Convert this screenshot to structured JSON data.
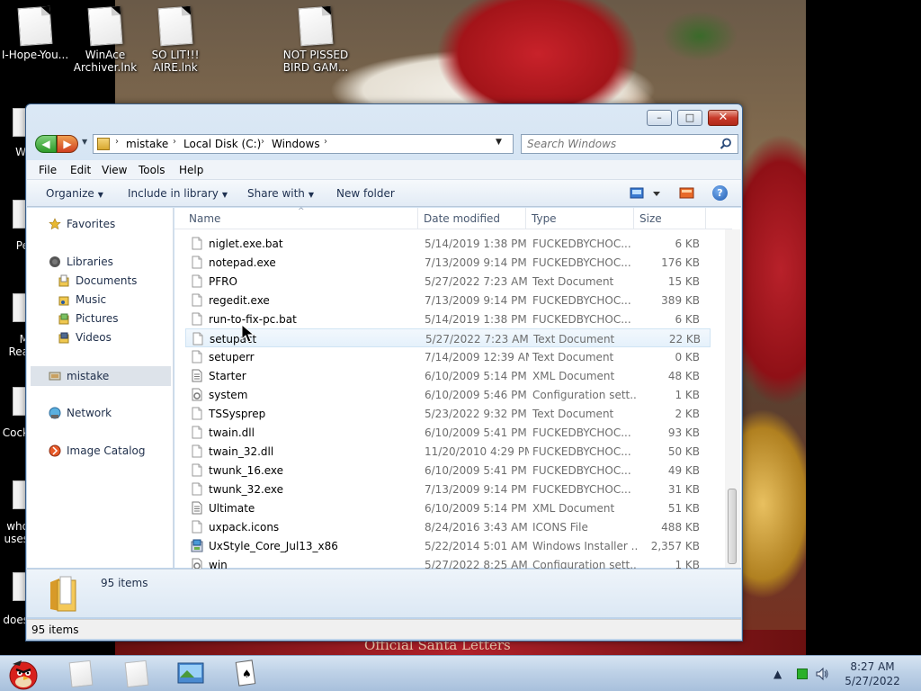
{
  "desktop": {
    "icons": [
      {
        "label": "I-Hope-You..."
      },
      {
        "label": "WinAce Archiver.lnk"
      },
      {
        "label": "SO LIT!!! AIRE.lnk"
      },
      {
        "label": "NOT PISSED BIRD GAM..."
      }
    ],
    "side_labels": [
      "Wi",
      "Pe",
      "M Rea",
      "Cock",
      "who uses",
      "does I"
    ],
    "wallpaper_text": "Official Santa Letters"
  },
  "window": {
    "title": "Windows",
    "caption_buttons": {
      "minimize": "–",
      "maximize": "□",
      "close": "✕"
    },
    "nav": {
      "back": "◀",
      "forward": "▶",
      "recent": "▼"
    },
    "breadcrumb": [
      "mistake",
      "Local Disk (C:)",
      "Windows"
    ],
    "search_placeholder": "Search Windows",
    "menu": [
      "File",
      "Edit",
      "View",
      "Tools",
      "Help"
    ],
    "commands": [
      "Organize",
      "Include in library",
      "Share with",
      "New folder"
    ],
    "help": "?",
    "nav_pane": [
      {
        "label": "Favorites",
        "icon": "star-icon",
        "child": false
      },
      {
        "label": "Libraries",
        "icon": "libraries-icon",
        "child": false
      },
      {
        "label": "Documents",
        "icon": "documents-icon",
        "child": true
      },
      {
        "label": "Music",
        "icon": "music-icon",
        "child": true
      },
      {
        "label": "Pictures",
        "icon": "pictures-icon",
        "child": true
      },
      {
        "label": "Videos",
        "icon": "videos-icon",
        "child": true
      },
      {
        "label": "mistake",
        "icon": "computer-icon",
        "child": false,
        "selected": true
      },
      {
        "label": "Network",
        "icon": "network-icon",
        "child": false
      },
      {
        "label": "Image Catalog",
        "icon": "image-catalog-icon",
        "child": false
      }
    ],
    "columns": {
      "name": "Name",
      "date": "Date modified",
      "type": "Type",
      "size": "Size"
    },
    "files": [
      {
        "name": "niglet.exe.bat",
        "date": "5/14/2019 1:38 PM",
        "type": "FUCKEDBYCHOC...",
        "size": "6 KB",
        "icon": "file-icon"
      },
      {
        "name": "notepad.exe",
        "date": "7/13/2009 9:14 PM",
        "type": "FUCKEDBYCHOC...",
        "size": "176 KB",
        "icon": "file-icon"
      },
      {
        "name": "PFRO",
        "date": "5/27/2022 7:23 AM",
        "type": "Text Document",
        "size": "15 KB",
        "icon": "file-icon"
      },
      {
        "name": "regedit.exe",
        "date": "7/13/2009 9:14 PM",
        "type": "FUCKEDBYCHOC...",
        "size": "389 KB",
        "icon": "file-icon"
      },
      {
        "name": "run-to-fix-pc.bat",
        "date": "5/14/2019 1:38 PM",
        "type": "FUCKEDBYCHOC...",
        "size": "6 KB",
        "icon": "file-icon"
      },
      {
        "name": "setupact",
        "date": "5/27/2022 7:23 AM",
        "type": "Text Document",
        "size": "22 KB",
        "icon": "file-icon",
        "hover": true
      },
      {
        "name": "setuperr",
        "date": "7/14/2009 12:39 AM",
        "type": "Text Document",
        "size": "0 KB",
        "icon": "file-icon"
      },
      {
        "name": "Starter",
        "date": "6/10/2009 5:14 PM",
        "type": "XML Document",
        "size": "48 KB",
        "icon": "xml-file-icon"
      },
      {
        "name": "system",
        "date": "6/10/2009 5:46 PM",
        "type": "Configuration sett...",
        "size": "1 KB",
        "icon": "config-file-icon"
      },
      {
        "name": "TSSysprep",
        "date": "5/23/2022 9:32 PM",
        "type": "Text Document",
        "size": "2 KB",
        "icon": "file-icon"
      },
      {
        "name": "twain.dll",
        "date": "6/10/2009 5:41 PM",
        "type": "FUCKEDBYCHOC...",
        "size": "93 KB",
        "icon": "file-icon"
      },
      {
        "name": "twain_32.dll",
        "date": "11/20/2010 4:29 PM",
        "type": "FUCKEDBYCHOC...",
        "size": "50 KB",
        "icon": "file-icon"
      },
      {
        "name": "twunk_16.exe",
        "date": "6/10/2009 5:41 PM",
        "type": "FUCKEDBYCHOC...",
        "size": "49 KB",
        "icon": "file-icon"
      },
      {
        "name": "twunk_32.exe",
        "date": "7/13/2009 9:14 PM",
        "type": "FUCKEDBYCHOC...",
        "size": "31 KB",
        "icon": "file-icon"
      },
      {
        "name": "Ultimate",
        "date": "6/10/2009 5:14 PM",
        "type": "XML Document",
        "size": "51 KB",
        "icon": "xml-file-icon"
      },
      {
        "name": "uxpack.icons",
        "date": "8/24/2016 3:43 AM",
        "type": "ICONS File",
        "size": "488 KB",
        "icon": "file-icon"
      },
      {
        "name": "UxStyle_Core_Jul13_x86",
        "date": "5/22/2014 5:01 AM",
        "type": "Windows Installer ...",
        "size": "2,357 KB",
        "icon": "installer-icon"
      },
      {
        "name": "win",
        "date": "5/27/2022 8:25 AM",
        "type": "Configuration sett...",
        "size": "1 KB",
        "icon": "config-file-icon"
      }
    ],
    "details_count": "95 items",
    "status": "95 items"
  },
  "taskbar": {
    "tray_arrow": "▲",
    "clock_time": "8:27 AM",
    "clock_date": "5/27/2022"
  },
  "colors": {
    "accent": "#3a5f8a",
    "selection": "#dde3ea",
    "hover": "#e5f1fb"
  }
}
